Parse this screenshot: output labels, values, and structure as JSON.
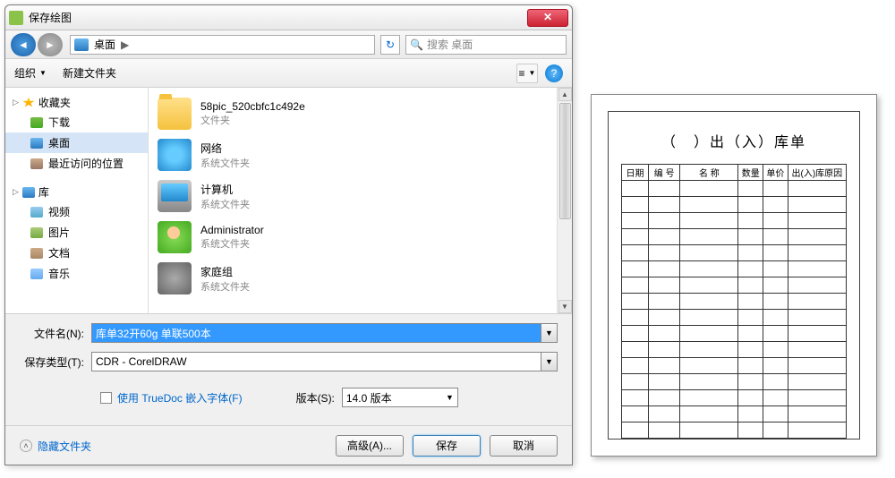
{
  "dialog": {
    "title": "保存绘图",
    "close": "✕",
    "nav": {
      "back": "◄",
      "forward": "►",
      "location": "桌面",
      "arrow": "▶",
      "refresh": "↻"
    },
    "search": {
      "placeholder": "搜索 桌面",
      "icon": "🔍"
    },
    "toolbar": {
      "organize": "组织",
      "newfolder": "新建文件夹",
      "dropdown": "▼",
      "view": "≡",
      "help": "?"
    },
    "sidebar": {
      "fav": {
        "label": "收藏夹",
        "items": [
          {
            "label": "下载",
            "cls": "dl"
          },
          {
            "label": "桌面",
            "cls": "dk",
            "sel": true
          },
          {
            "label": "最近访问的位置",
            "cls": "rc"
          }
        ]
      },
      "lib": {
        "label": "库",
        "items": [
          {
            "label": "视频",
            "cls": "vd"
          },
          {
            "label": "图片",
            "cls": "pc"
          },
          {
            "label": "文档",
            "cls": "dc"
          },
          {
            "label": "音乐",
            "cls": "ms"
          }
        ]
      }
    },
    "files": [
      {
        "name": "58pic_520cbfc1c492e",
        "type": "文件夹",
        "cls": "fld"
      },
      {
        "name": "网络",
        "type": "系统文件夹",
        "cls": "net"
      },
      {
        "name": "计算机",
        "type": "系统文件夹",
        "cls": "cmp"
      },
      {
        "name": "Administrator",
        "type": "系统文件夹",
        "cls": "usr"
      },
      {
        "name": "家庭组",
        "type": "系统文件夹",
        "cls": "grp"
      }
    ],
    "scroll": {
      "up": "▲",
      "down": "▼"
    },
    "form": {
      "filename_label": "文件名(N):",
      "filename_value": "库单32开60g 单联500本",
      "filetype_label": "保存类型(T):",
      "filetype_value": "CDR - CorelDRAW",
      "truedoc": "使用 TrueDoc 嵌入字体(F)",
      "version_label": "版本(S):",
      "version_value": "14.0 版本"
    },
    "footer": {
      "hidden": "隐藏文件夹",
      "advanced": "高级(A)...",
      "save": "保存",
      "cancel": "取消"
    }
  },
  "preview": {
    "title": "（　）出（入）库单",
    "headers": [
      "日期",
      "编 号",
      "名 称",
      "数量",
      "单价",
      "出(入)库原因"
    ],
    "rows": 16
  }
}
